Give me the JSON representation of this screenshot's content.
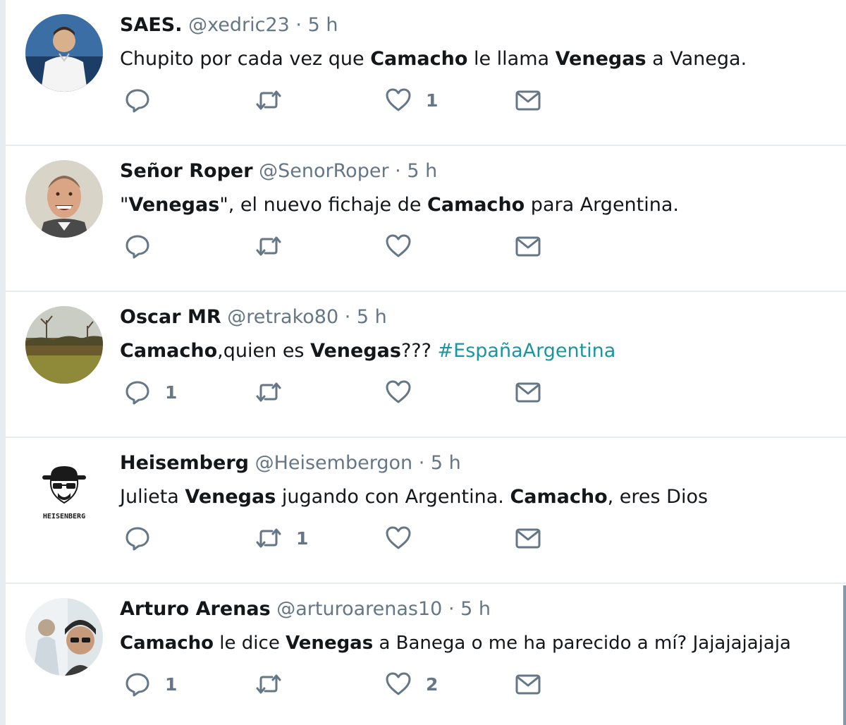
{
  "tweets": [
    {
      "name": "SAES.",
      "handle": "@xedric23",
      "time": "5 h",
      "parts": [
        {
          "t": "Chupito por cada vez que ",
          "s": "n"
        },
        {
          "t": "Camacho",
          "s": "b"
        },
        {
          "t": " le llama ",
          "s": "n"
        },
        {
          "t": "Venegas",
          "s": "b"
        },
        {
          "t": " a Vanega.",
          "s": "n"
        }
      ],
      "replies": "",
      "retweets": "",
      "likes": "1",
      "avatar_icon": "soccer-player-avatar"
    },
    {
      "name": "Señor Roper",
      "handle": "@SenorRoper",
      "time": "5 h",
      "parts": [
        {
          "t": "\"",
          "s": "n"
        },
        {
          "t": "Venegas",
          "s": "b"
        },
        {
          "t": "\", el nuevo fichaje de ",
          "s": "n"
        },
        {
          "t": "Camacho",
          "s": "b"
        },
        {
          "t": " para Argentina.",
          "s": "n"
        }
      ],
      "replies": "",
      "retweets": "",
      "likes": "",
      "avatar_icon": "laughing-man-avatar"
    },
    {
      "name": "Oscar MR",
      "handle": "@retrako80",
      "time": "5 h",
      "parts": [
        {
          "t": "Camacho",
          "s": "b"
        },
        {
          "t": ",quien es ",
          "s": "n"
        },
        {
          "t": "Venegas",
          "s": "b"
        },
        {
          "t": "??? ",
          "s": "n"
        },
        {
          "t": "#EspañaArgentina",
          "s": "h"
        }
      ],
      "replies": "1",
      "retweets": "",
      "likes": "",
      "avatar_icon": "landscape-avatar"
    },
    {
      "name": "Heisemberg",
      "handle": "@Heisembergon",
      "time": "5 h",
      "parts": [
        {
          "t": "Julieta ",
          "s": "n"
        },
        {
          "t": "Venegas",
          "s": "b"
        },
        {
          "t": " jugando con Argentina. ",
          "s": "n"
        },
        {
          "t": "Camacho",
          "s": "b"
        },
        {
          "t": ", eres Dios",
          "s": "n"
        }
      ],
      "replies": "",
      "retweets": "1",
      "likes": "",
      "avatar_icon": "heisenberg-hat-avatar",
      "avatar_label": "HEISENBERG"
    },
    {
      "name": "Arturo Arenas",
      "handle": "@arturoarenas10",
      "time": "5 h",
      "parts": [
        {
          "t": "Camacho",
          "s": "b"
        },
        {
          "t": " le dice ",
          "s": "n"
        },
        {
          "t": "Venegas",
          "s": "b"
        },
        {
          "t": " a Banega o me ha parecido a mí? Jajajajajaja",
          "s": "n"
        }
      ],
      "replies": "1",
      "retweets": "",
      "likes": "2",
      "avatar_icon": "selfie-avatar"
    }
  ],
  "separator": "·",
  "colors": {
    "text": "#14171a",
    "secondary": "#657786",
    "hashtag": "#1b95a0",
    "border": "#e6ecf0"
  }
}
